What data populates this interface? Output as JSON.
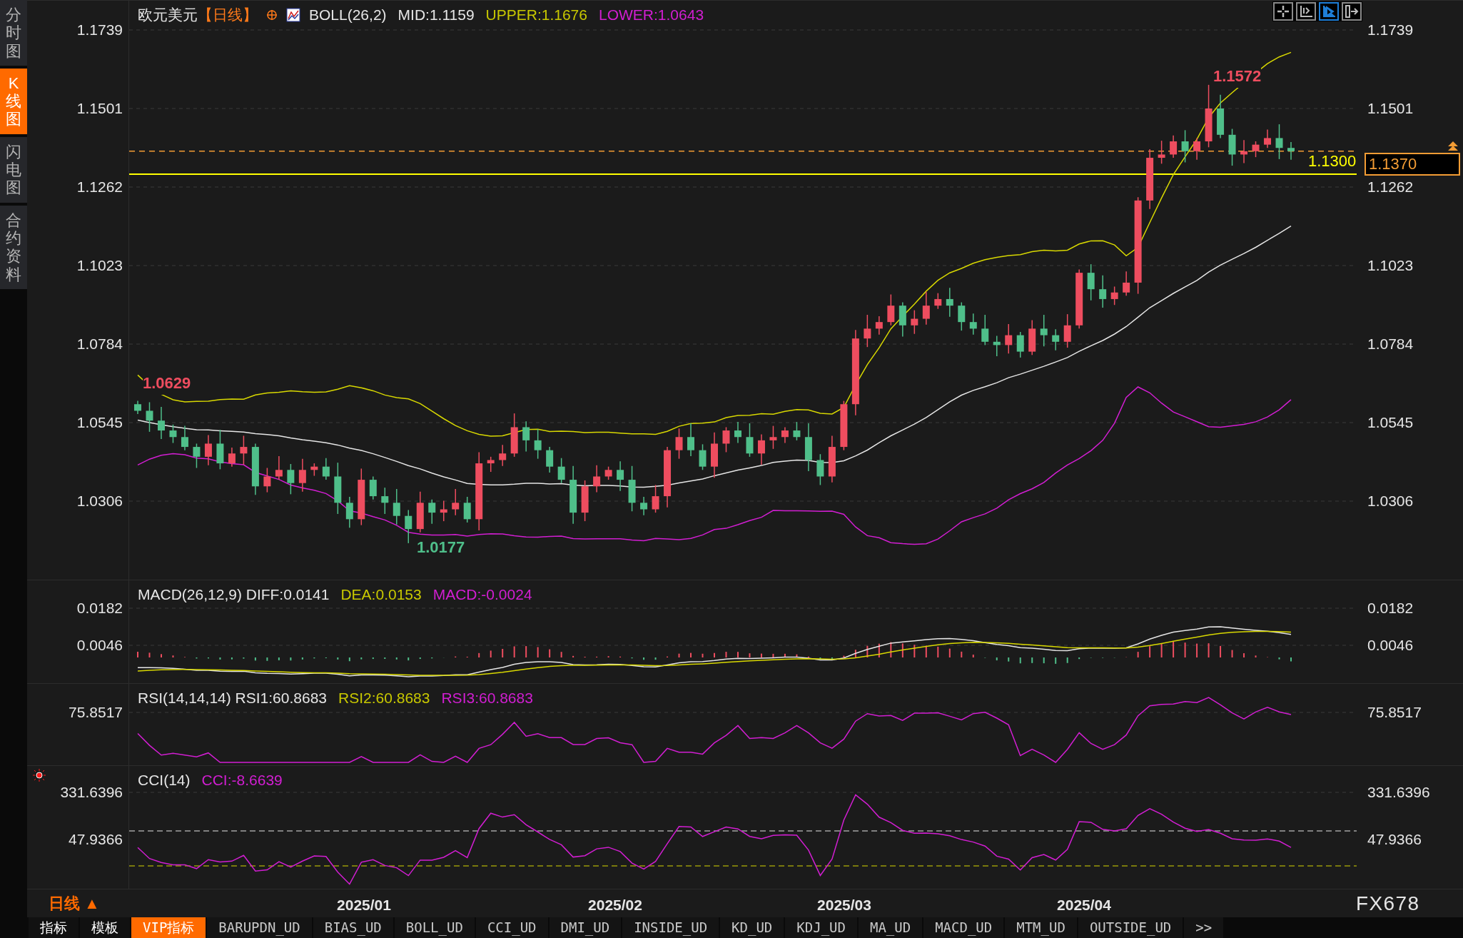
{
  "sidebar": [
    {
      "label": "分时图",
      "selected": false
    },
    {
      "label": "K线图",
      "selected": true
    },
    {
      "label": "闪电图",
      "selected": false
    },
    {
      "label": "合约资料",
      "selected": false
    }
  ],
  "main_chart": {
    "symbol": "欧元美元",
    "period": "【日线】",
    "legend": [
      {
        "text": "BOLL(26,2)",
        "color": "#e6e6e6"
      },
      {
        "text": "MID:1.1159",
        "color": "#e6e6e6"
      },
      {
        "text": "UPPER:1.1676",
        "color": "#c8c800"
      },
      {
        "text": "LOWER:1.0643",
        "color": "#d21ed2"
      }
    ],
    "left_ticks": [
      "1.1739",
      "1.1501",
      "1.1262",
      "1.1023",
      "1.0784",
      "1.0545",
      "1.0306"
    ],
    "right_ticks": [
      "1.1739",
      "1.1501",
      "1.1262",
      "1.1023",
      "1.0784",
      "1.0545",
      "1.0306"
    ],
    "start_label": "1.0629",
    "low_label": "1.0177",
    "high_label": "1.1572",
    "line_label": "1.1300",
    "current_price": "1.1370"
  },
  "macd": {
    "legend": [
      {
        "text": "MACD(26,12,9) DIFF:0.0141",
        "color": "#e6e6e6"
      },
      {
        "text": "DEA:0.0153",
        "color": "#c8c800"
      },
      {
        "text": "MACD:-0.0024",
        "color": "#d21ed2"
      }
    ],
    "left_ticks": [
      "0.0182",
      "0.0046"
    ],
    "right_ticks": [
      "0.0182",
      "0.0046"
    ]
  },
  "rsi": {
    "legend": [
      {
        "text": "RSI(14,14,14) RSI1:60.8683",
        "color": "#e6e6e6"
      },
      {
        "text": "RSI2:60.8683",
        "color": "#c8c800"
      },
      {
        "text": "RSI3:60.8683",
        "color": "#d21ed2"
      }
    ],
    "left_ticks": [
      "75.8517"
    ],
    "right_ticks": [
      "75.8517"
    ]
  },
  "cci": {
    "legend": [
      {
        "text": "CCI(14)",
        "color": "#e6e6e6"
      },
      {
        "text": "CCI:-8.6639",
        "color": "#d21ed2"
      }
    ],
    "left_ticks": [
      "331.6396",
      "47.9366"
    ],
    "right_ticks": [
      "331.6396",
      "47.9366"
    ]
  },
  "date_axis": {
    "period": "日线 ▲",
    "dates": [
      "2025/01",
      "2025/02",
      "2025/03",
      "2025/04"
    ]
  },
  "tabs": [
    {
      "label": "指标",
      "selected": false
    },
    {
      "label": "模板",
      "selected": false
    },
    {
      "label": "VIP指标",
      "selected": true
    },
    {
      "label": "BARUPDN_UD",
      "selected": false
    },
    {
      "label": "BIAS_UD",
      "selected": false
    },
    {
      "label": "BOLL_UD",
      "selected": false
    },
    {
      "label": "CCI_UD",
      "selected": false
    },
    {
      "label": "DMI_UD",
      "selected": false
    },
    {
      "label": "INSIDE_UD",
      "selected": false
    },
    {
      "label": "KD_UD",
      "selected": false
    },
    {
      "label": "KDJ_UD",
      "selected": false
    },
    {
      "label": "MA_UD",
      "selected": false
    },
    {
      "label": "MACD_UD",
      "selected": false
    },
    {
      "label": "MTM_UD",
      "selected": false
    },
    {
      "label": "OUTSIDE_UD",
      "selected": false
    },
    {
      "label": ">>",
      "selected": false
    }
  ],
  "logo": "FX678"
}
